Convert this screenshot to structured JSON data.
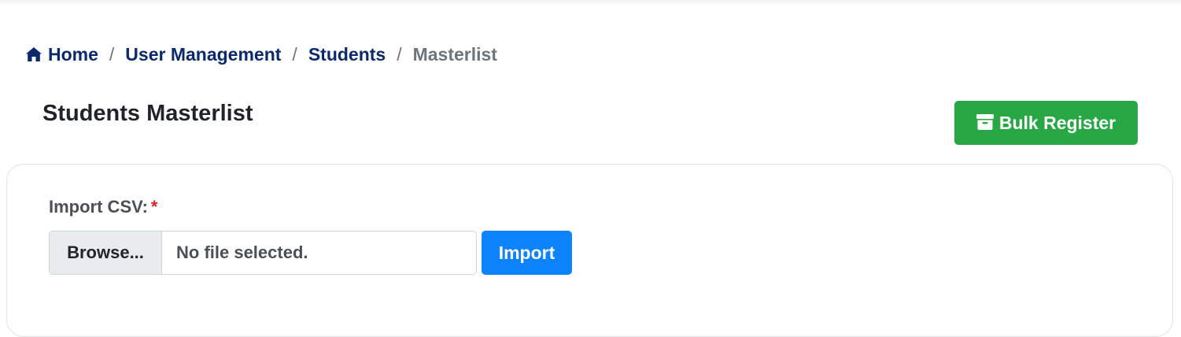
{
  "breadcrumb": {
    "icon": "home-icon",
    "items": [
      {
        "label": "Home"
      },
      {
        "label": "User Management"
      },
      {
        "label": "Students"
      },
      {
        "label": "Masterlist"
      }
    ],
    "separator": "/"
  },
  "header": {
    "title": "Students Masterlist",
    "bulk_register": {
      "icon": "archive-icon",
      "label": "Bulk Register"
    }
  },
  "form": {
    "import_label": "Import CSV:",
    "required_mark": "*",
    "file_input": {
      "browse_label": "Browse...",
      "status": "No file selected."
    },
    "import_button": "Import"
  },
  "colors": {
    "breadcrumb_link": "#0b2a6b",
    "breadcrumb_active": "#6c757d",
    "success": "#28a745",
    "primary": "#0d83fd",
    "required": "#e02424"
  }
}
